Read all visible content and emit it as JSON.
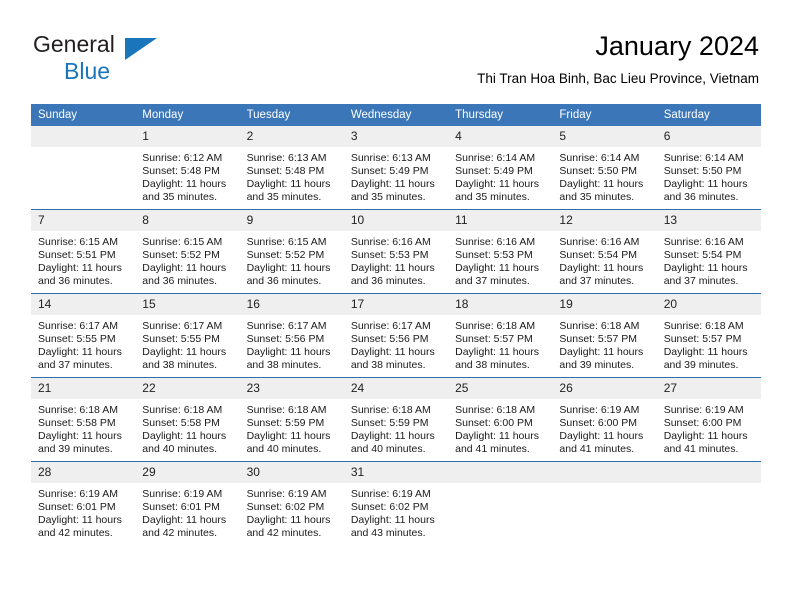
{
  "brand": {
    "line1": "General",
    "line2": "Blue",
    "flag_color": "#1b75bb"
  },
  "header": {
    "title": "January 2024",
    "subtitle": "Thi Tran Hoa Binh, Bac Lieu Province, Vietnam",
    "accent_color": "#3a76b8",
    "daynum_band_color": "#efefef"
  },
  "calendar": {
    "weekday_headers": [
      "Sunday",
      "Monday",
      "Tuesday",
      "Wednesday",
      "Thursday",
      "Friday",
      "Saturday"
    ],
    "weeks": [
      [
        {
          "day": "",
          "blank": true,
          "sunrise": "",
          "sunset": "",
          "daylight1": "",
          "daylight2": ""
        },
        {
          "day": "1",
          "sunrise": "Sunrise: 6:12 AM",
          "sunset": "Sunset: 5:48 PM",
          "daylight1": "Daylight: 11 hours",
          "daylight2": "and 35 minutes."
        },
        {
          "day": "2",
          "sunrise": "Sunrise: 6:13 AM",
          "sunset": "Sunset: 5:48 PM",
          "daylight1": "Daylight: 11 hours",
          "daylight2": "and 35 minutes."
        },
        {
          "day": "3",
          "sunrise": "Sunrise: 6:13 AM",
          "sunset": "Sunset: 5:49 PM",
          "daylight1": "Daylight: 11 hours",
          "daylight2": "and 35 minutes."
        },
        {
          "day": "4",
          "sunrise": "Sunrise: 6:14 AM",
          "sunset": "Sunset: 5:49 PM",
          "daylight1": "Daylight: 11 hours",
          "daylight2": "and 35 minutes."
        },
        {
          "day": "5",
          "sunrise": "Sunrise: 6:14 AM",
          "sunset": "Sunset: 5:50 PM",
          "daylight1": "Daylight: 11 hours",
          "daylight2": "and 35 minutes."
        },
        {
          "day": "6",
          "sunrise": "Sunrise: 6:14 AM",
          "sunset": "Sunset: 5:50 PM",
          "daylight1": "Daylight: 11 hours",
          "daylight2": "and 36 minutes."
        }
      ],
      [
        {
          "day": "7",
          "sunrise": "Sunrise: 6:15 AM",
          "sunset": "Sunset: 5:51 PM",
          "daylight1": "Daylight: 11 hours",
          "daylight2": "and 36 minutes."
        },
        {
          "day": "8",
          "sunrise": "Sunrise: 6:15 AM",
          "sunset": "Sunset: 5:52 PM",
          "daylight1": "Daylight: 11 hours",
          "daylight2": "and 36 minutes."
        },
        {
          "day": "9",
          "sunrise": "Sunrise: 6:15 AM",
          "sunset": "Sunset: 5:52 PM",
          "daylight1": "Daylight: 11 hours",
          "daylight2": "and 36 minutes."
        },
        {
          "day": "10",
          "sunrise": "Sunrise: 6:16 AM",
          "sunset": "Sunset: 5:53 PM",
          "daylight1": "Daylight: 11 hours",
          "daylight2": "and 36 minutes."
        },
        {
          "day": "11",
          "sunrise": "Sunrise: 6:16 AM",
          "sunset": "Sunset: 5:53 PM",
          "daylight1": "Daylight: 11 hours",
          "daylight2": "and 37 minutes."
        },
        {
          "day": "12",
          "sunrise": "Sunrise: 6:16 AM",
          "sunset": "Sunset: 5:54 PM",
          "daylight1": "Daylight: 11 hours",
          "daylight2": "and 37 minutes."
        },
        {
          "day": "13",
          "sunrise": "Sunrise: 6:16 AM",
          "sunset": "Sunset: 5:54 PM",
          "daylight1": "Daylight: 11 hours",
          "daylight2": "and 37 minutes."
        }
      ],
      [
        {
          "day": "14",
          "sunrise": "Sunrise: 6:17 AM",
          "sunset": "Sunset: 5:55 PM",
          "daylight1": "Daylight: 11 hours",
          "daylight2": "and 37 minutes."
        },
        {
          "day": "15",
          "sunrise": "Sunrise: 6:17 AM",
          "sunset": "Sunset: 5:55 PM",
          "daylight1": "Daylight: 11 hours",
          "daylight2": "and 38 minutes."
        },
        {
          "day": "16",
          "sunrise": "Sunrise: 6:17 AM",
          "sunset": "Sunset: 5:56 PM",
          "daylight1": "Daylight: 11 hours",
          "daylight2": "and 38 minutes."
        },
        {
          "day": "17",
          "sunrise": "Sunrise: 6:17 AM",
          "sunset": "Sunset: 5:56 PM",
          "daylight1": "Daylight: 11 hours",
          "daylight2": "and 38 minutes."
        },
        {
          "day": "18",
          "sunrise": "Sunrise: 6:18 AM",
          "sunset": "Sunset: 5:57 PM",
          "daylight1": "Daylight: 11 hours",
          "daylight2": "and 38 minutes."
        },
        {
          "day": "19",
          "sunrise": "Sunrise: 6:18 AM",
          "sunset": "Sunset: 5:57 PM",
          "daylight1": "Daylight: 11 hours",
          "daylight2": "and 39 minutes."
        },
        {
          "day": "20",
          "sunrise": "Sunrise: 6:18 AM",
          "sunset": "Sunset: 5:57 PM",
          "daylight1": "Daylight: 11 hours",
          "daylight2": "and 39 minutes."
        }
      ],
      [
        {
          "day": "21",
          "sunrise": "Sunrise: 6:18 AM",
          "sunset": "Sunset: 5:58 PM",
          "daylight1": "Daylight: 11 hours",
          "daylight2": "and 39 minutes."
        },
        {
          "day": "22",
          "sunrise": "Sunrise: 6:18 AM",
          "sunset": "Sunset: 5:58 PM",
          "daylight1": "Daylight: 11 hours",
          "daylight2": "and 40 minutes."
        },
        {
          "day": "23",
          "sunrise": "Sunrise: 6:18 AM",
          "sunset": "Sunset: 5:59 PM",
          "daylight1": "Daylight: 11 hours",
          "daylight2": "and 40 minutes."
        },
        {
          "day": "24",
          "sunrise": "Sunrise: 6:18 AM",
          "sunset": "Sunset: 5:59 PM",
          "daylight1": "Daylight: 11 hours",
          "daylight2": "and 40 minutes."
        },
        {
          "day": "25",
          "sunrise": "Sunrise: 6:18 AM",
          "sunset": "Sunset: 6:00 PM",
          "daylight1": "Daylight: 11 hours",
          "daylight2": "and 41 minutes."
        },
        {
          "day": "26",
          "sunrise": "Sunrise: 6:19 AM",
          "sunset": "Sunset: 6:00 PM",
          "daylight1": "Daylight: 11 hours",
          "daylight2": "and 41 minutes."
        },
        {
          "day": "27",
          "sunrise": "Sunrise: 6:19 AM",
          "sunset": "Sunset: 6:00 PM",
          "daylight1": "Daylight: 11 hours",
          "daylight2": "and 41 minutes."
        }
      ],
      [
        {
          "day": "28",
          "sunrise": "Sunrise: 6:19 AM",
          "sunset": "Sunset: 6:01 PM",
          "daylight1": "Daylight: 11 hours",
          "daylight2": "and 42 minutes."
        },
        {
          "day": "29",
          "sunrise": "Sunrise: 6:19 AM",
          "sunset": "Sunset: 6:01 PM",
          "daylight1": "Daylight: 11 hours",
          "daylight2": "and 42 minutes."
        },
        {
          "day": "30",
          "sunrise": "Sunrise: 6:19 AM",
          "sunset": "Sunset: 6:02 PM",
          "daylight1": "Daylight: 11 hours",
          "daylight2": "and 42 minutes."
        },
        {
          "day": "31",
          "sunrise": "Sunrise: 6:19 AM",
          "sunset": "Sunset: 6:02 PM",
          "daylight1": "Daylight: 11 hours",
          "daylight2": "and 43 minutes."
        },
        {
          "day": "",
          "blank": true,
          "sunrise": "",
          "sunset": "",
          "daylight1": "",
          "daylight2": ""
        },
        {
          "day": "",
          "blank": true,
          "sunrise": "",
          "sunset": "",
          "daylight1": "",
          "daylight2": ""
        },
        {
          "day": "",
          "blank": true,
          "sunrise": "",
          "sunset": "",
          "daylight1": "",
          "daylight2": ""
        }
      ]
    ]
  }
}
